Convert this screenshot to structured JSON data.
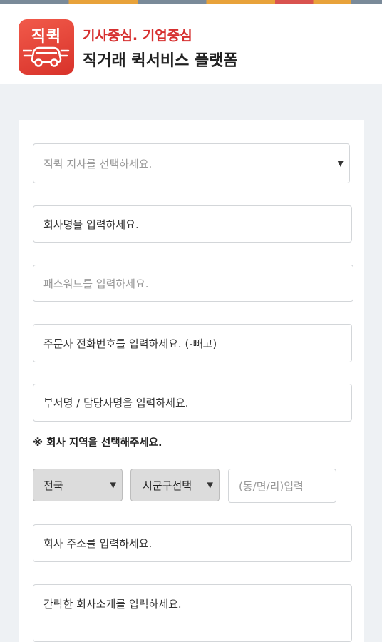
{
  "colors": {
    "accent": "#d62f2f",
    "logo_bg": "#e8453b",
    "page_bg": "#eef1f4"
  },
  "header": {
    "logo_text": "직퀵",
    "logo_icon": "delivery-car-icon",
    "tagline": "기사중심. 기업중심",
    "title": "직거래 퀵서비스 플랫폼"
  },
  "form": {
    "branch_select": {
      "placeholder": "직퀵 지사를 선택하세요."
    },
    "company_name": {
      "value": "회사명을 입력하세요."
    },
    "password": {
      "placeholder": "패스워드를 입력하세요."
    },
    "phone": {
      "value": "주문자 전화번호를 입력하세요. (-빼고)"
    },
    "department": {
      "value": "부서명 / 담당자명을 입력하세요."
    },
    "region_notice": "※ 회사 지역을 선택해주세요.",
    "region_select": {
      "selected": "전국"
    },
    "district_select": {
      "selected": "시군구선택"
    },
    "dong_input": {
      "placeholder": "(동/면/리)입력"
    },
    "address": {
      "value": "회사 주소를 입력하세요."
    },
    "intro": {
      "value": "간략한 회사소개를 입력하세요."
    }
  }
}
